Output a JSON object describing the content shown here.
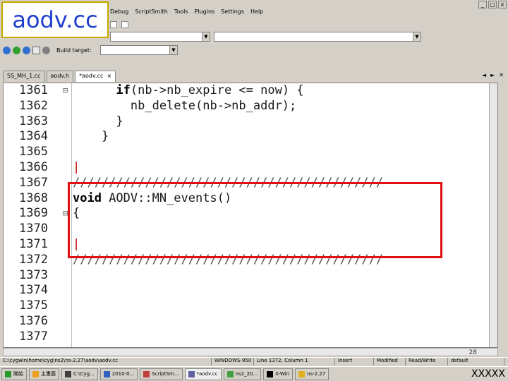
{
  "slide_label": "aodv.cc",
  "menubar": {
    "items": [
      "Debug",
      "ScriptSmith",
      "Tools",
      "Plugins",
      "Settings",
      "Help"
    ]
  },
  "build_target": {
    "label": "Build target:",
    "value": ""
  },
  "tabs": [
    {
      "label": "SS_MH_1.cc",
      "active": false
    },
    {
      "label": "aodv.h",
      "active": false
    },
    {
      "label": "*aodv.cc",
      "active": true
    }
  ],
  "tab_close": "×",
  "tab_nav": [
    "◄",
    "►",
    "✕"
  ],
  "window_controls": [
    "_",
    "□",
    "×"
  ],
  "line_numbers": [
    "1361",
    "1362",
    "1363",
    "1364",
    "1365",
    "1366",
    "1367",
    "1368",
    "1369",
    "1370",
    "1371",
    "1372",
    "1373",
    "1374",
    "1375",
    "1376",
    "1377"
  ],
  "code_lines": [
    {
      "text": "      if(nb->nb_expire <= now) {",
      "kind": "kw"
    },
    {
      "text": "        nb_delete(nb->nb_addr);",
      "kind": "normal"
    },
    {
      "text": "      }",
      "kind": "normal"
    },
    {
      "text": "    }",
      "kind": "normal"
    },
    {
      "text": "",
      "kind": "normal"
    },
    {
      "text": "|",
      "kind": "red"
    },
    {
      "text": "///////////////////////////////////////////",
      "kind": "cm"
    },
    {
      "text": "void AODV::MN_events()",
      "kind": "kw2"
    },
    {
      "text": "{",
      "kind": "normal"
    },
    {
      "text": "",
      "kind": "normal"
    },
    {
      "text": "|",
      "kind": "red"
    },
    {
      "text": "///////////////////////////////////////////",
      "kind": "cm"
    },
    {
      "text": "",
      "kind": "normal"
    },
    {
      "text": "",
      "kind": "normal"
    },
    {
      "text": "",
      "kind": "normal"
    },
    {
      "text": "",
      "kind": "normal"
    },
    {
      "text": "",
      "kind": "normal"
    }
  ],
  "page_number": "28",
  "status": [
    "C:\\cygwin\\home\\cyg\\ns2\\ns-2.27\\aodv\\aodv.cc",
    "WINDOWS-950",
    "Line 1372, Column 1",
    "Insert",
    "Modified",
    "Read/Write",
    "default"
  ],
  "taskbar": [
    {
      "label": "開始",
      "color": "#2a9a2a"
    },
    {
      "label": "主畫面",
      "color": "#f0a020"
    },
    {
      "label": "C:\\Cyg...",
      "color": "#404040"
    },
    {
      "label": "2010-0...",
      "color": "#3060c0"
    },
    {
      "label": "ScriptSm...",
      "color": "#c04040"
    },
    {
      "label": "*aodv.cc",
      "color": "#6060a0",
      "active": true
    },
    {
      "label": "ns2_20...",
      "color": "#40a040"
    },
    {
      "label": "X-Win",
      "color": "#000000"
    },
    {
      "label": "ns-2.27",
      "color": "#e0b020"
    }
  ],
  "tray_text": "XXXXX",
  "colors": {
    "highlight": "#e01010",
    "label_text": "#1f3fd0"
  }
}
